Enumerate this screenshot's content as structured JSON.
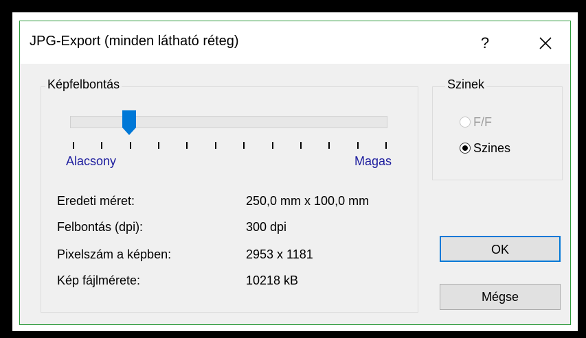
{
  "window": {
    "title": "JPG-Export (minden látható réteg)",
    "help_label": "?",
    "close_icon": "close-icon"
  },
  "resolution": {
    "group_label": "Képfelbontás",
    "slider_low_label": "Alacsony",
    "slider_high_label": "Magas",
    "slider_position_fraction": 0.18,
    "tick_count": 12
  },
  "info": {
    "original_size_label": "Eredeti méret:",
    "original_size_value": "250,0 mm x 100,0 mm",
    "dpi_label": "Felbontás (dpi):",
    "dpi_value": "300 dpi",
    "pixels_label": "Pixelszám a képben:",
    "pixels_value": "2953 x 1181",
    "filesize_label": "Kép fájlmérete:",
    "filesize_value": "10218 kB"
  },
  "colors": {
    "group_label": "Szinek",
    "option_bw_label": "F/F",
    "option_color_label": "Szines",
    "selected": "Szines"
  },
  "buttons": {
    "ok_label": "OK",
    "cancel_label": "Mégse"
  },
  "theme": {
    "accent": "#0078d7",
    "frame_border": "#2e9b3c",
    "slider_thumb": "#0078d7",
    "link_text": "#1c1c9e"
  }
}
